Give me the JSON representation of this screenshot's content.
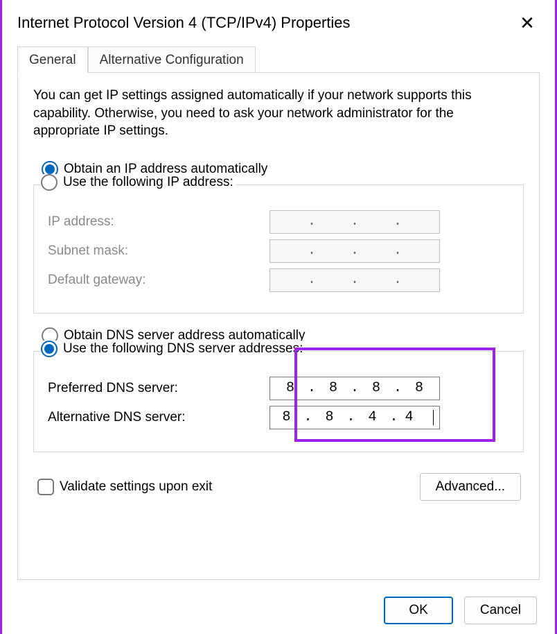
{
  "window": {
    "title": "Internet Protocol Version 4 (TCP/IPv4) Properties"
  },
  "tabs": {
    "general": "General",
    "alternative": "Alternative Configuration"
  },
  "panel": {
    "description": "You can get IP settings assigned automatically if your network supports this capability. Otherwise, you need to ask your network administrator for the appropriate IP settings."
  },
  "ip_section": {
    "auto_label": "Obtain an IP address automatically",
    "manual_label": "Use the following IP address:",
    "ip_address_label": "IP address:",
    "subnet_label": "Subnet mask:",
    "gateway_label": "Default gateway:",
    "ip_address_value": [
      "",
      "",
      "",
      ""
    ],
    "subnet_value": [
      "",
      "",
      "",
      ""
    ],
    "gateway_value": [
      "",
      "",
      "",
      ""
    ]
  },
  "dns_section": {
    "auto_label": "Obtain DNS server address automatically",
    "manual_label": "Use the following DNS server addresses:",
    "preferred_label": "Preferred DNS server:",
    "alternate_label": "Alternative DNS server:",
    "preferred_value": [
      "8",
      "8",
      "8",
      "8"
    ],
    "alternate_value": [
      "8",
      "8",
      "4",
      "4"
    ]
  },
  "validate_label": "Validate settings upon exit",
  "buttons": {
    "advanced": "Advanced...",
    "ok": "OK",
    "cancel": "Cancel"
  }
}
